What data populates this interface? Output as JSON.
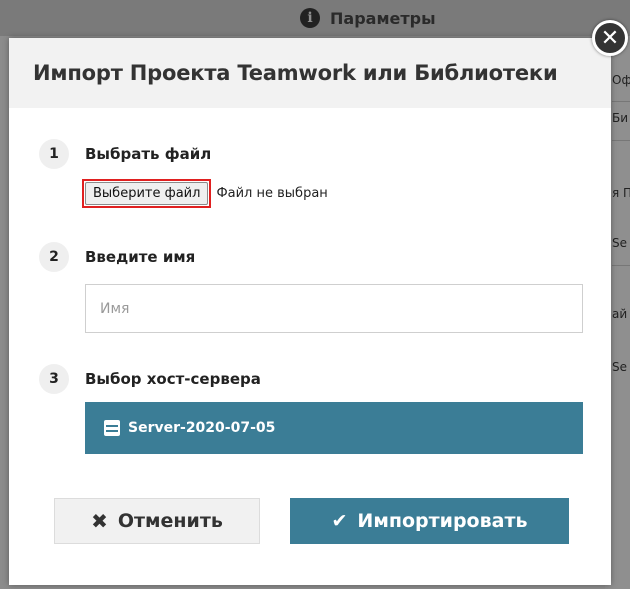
{
  "background": {
    "header_label": "Параметры",
    "right_fragments": [
      "Оф",
      "Би",
      "я П",
      "Se",
      "ай",
      "Se"
    ]
  },
  "dialog": {
    "title": "Импорт Проекта Teamwork или Библиотеки",
    "close_icon": "close-icon",
    "steps": [
      {
        "number": "1",
        "label": "Выбрать файл"
      },
      {
        "number": "2",
        "label": "Введите имя"
      },
      {
        "number": "3",
        "label": "Выбор хост-сервера"
      }
    ],
    "file_picker": {
      "button_label": "Выберите файл",
      "status": "Файл не выбран"
    },
    "name_field": {
      "value": "",
      "placeholder": "Имя"
    },
    "servers": [
      {
        "label": "Server-2020-07-05",
        "selected": true,
        "icon": "server-icon"
      }
    ],
    "buttons": {
      "cancel": {
        "label": "Отменить",
        "icon": "x-icon"
      },
      "import": {
        "label": "Импортировать",
        "icon": "checkmark-icon"
      }
    }
  },
  "colors": {
    "accent": "#3b7d96",
    "highlight_border": "#e02020",
    "overlay": "#8f8f8f"
  }
}
